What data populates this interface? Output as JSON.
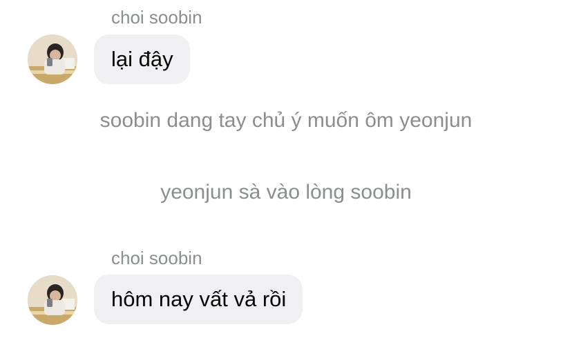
{
  "messages": [
    {
      "sender": "choi soobin",
      "text": "lại đậy"
    },
    {
      "sender": "choi soobin",
      "text": "hôm nay vất vả rồi"
    }
  ],
  "narrations": [
    "soobin dang tay chủ ý muốn ôm yeonjun",
    "yeonjun sà vào lòng soobin"
  ],
  "colors": {
    "bubble": "#f0f0f2",
    "narration_text": "#8a8d91",
    "message_text": "#050505"
  },
  "icons": {
    "avatar": "avatar-photo"
  }
}
